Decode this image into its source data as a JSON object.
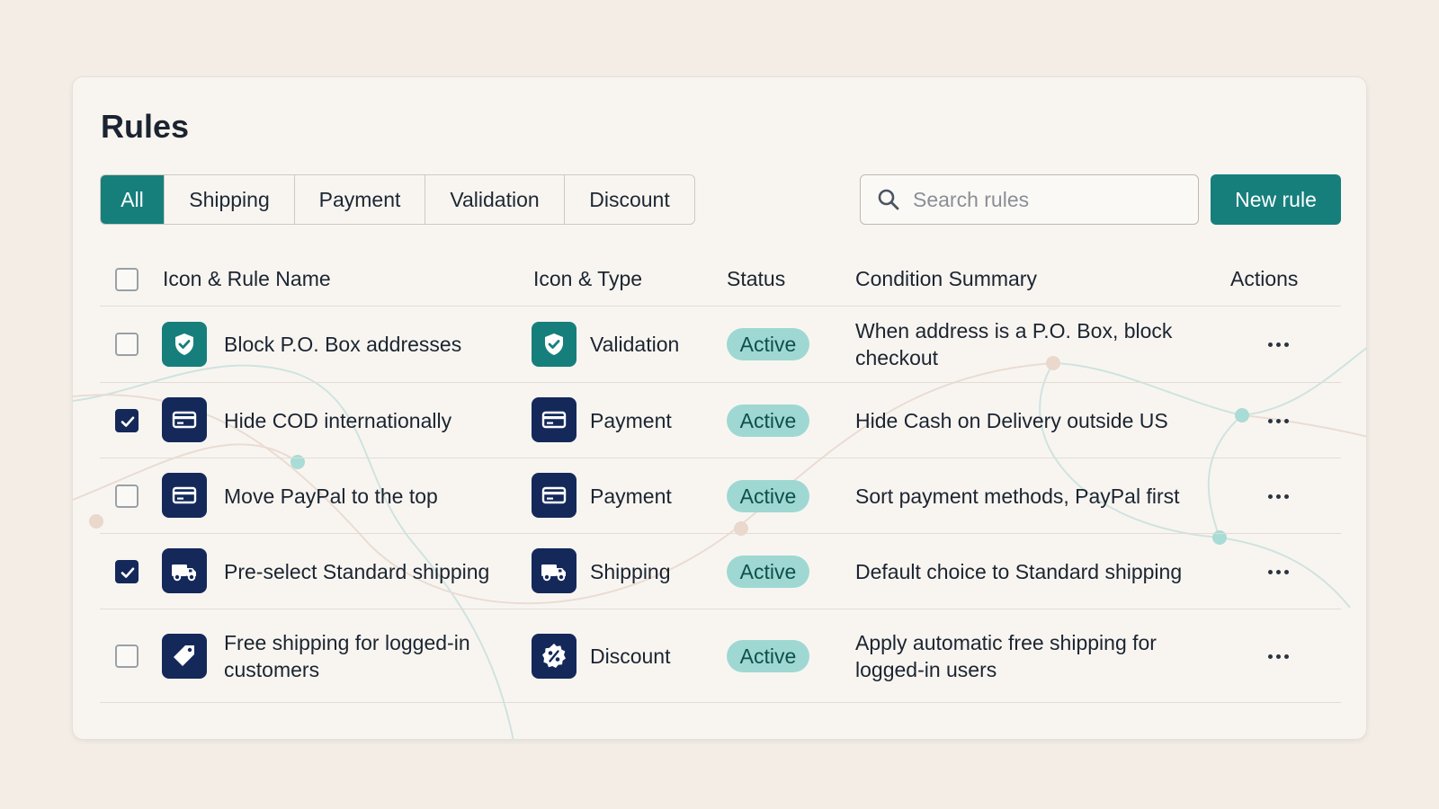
{
  "page": {
    "title": "Rules"
  },
  "filters": {
    "tabs": [
      {
        "label": "All",
        "active": true
      },
      {
        "label": "Shipping",
        "active": false
      },
      {
        "label": "Payment",
        "active": false
      },
      {
        "label": "Validation",
        "active": false
      },
      {
        "label": "Discount",
        "active": false
      }
    ]
  },
  "search": {
    "placeholder": "Search rules",
    "value": ""
  },
  "toolbar": {
    "new_rule_label": "New rule"
  },
  "table": {
    "headers": {
      "name": "Icon & Rule Name",
      "type": "Icon & Type",
      "status": "Status",
      "condition": "Condition Summary",
      "actions": "Actions"
    },
    "rows": [
      {
        "checked": false,
        "name_icon": "shield-check-icon",
        "name": "Block P.O. Box addresses",
        "type_icon": "shield-check-icon",
        "type": "Validation",
        "status": "Active",
        "condition": "When address is a P.O. Box, block checkout"
      },
      {
        "checked": true,
        "name_icon": "credit-card-icon",
        "name": "Hide COD internationally",
        "type_icon": "credit-card-icon",
        "type": "Payment",
        "status": "Active",
        "condition": "Hide Cash on Delivery outside US"
      },
      {
        "checked": false,
        "name_icon": "credit-card-icon",
        "name": "Move PayPal to the top",
        "type_icon": "credit-card-icon",
        "type": "Payment",
        "status": "Active",
        "condition": "Sort payment methods, PayPal first"
      },
      {
        "checked": true,
        "name_icon": "truck-icon",
        "name": "Pre-select Standard shipping",
        "type_icon": "truck-icon",
        "type": "Shipping",
        "status": "Active",
        "condition": "Default choice to Standard shipping"
      },
      {
        "checked": false,
        "name_icon": "tag-icon",
        "name": "Free shipping for logged-in customers",
        "type_icon": "percent-badge-icon",
        "type": "Discount",
        "status": "Active",
        "condition": "Apply automatic free shipping for logged-in users"
      }
    ]
  },
  "colors": {
    "accent": "#167f7c",
    "navy": "#14295a",
    "badge_bg": "#9fd8d2",
    "background": "#f3ede6"
  }
}
